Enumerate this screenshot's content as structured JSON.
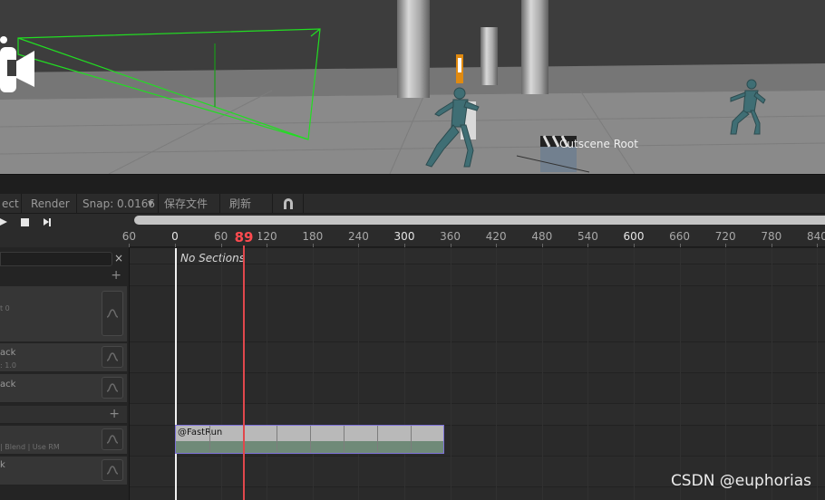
{
  "scene": {
    "object_label": "Cutscene Root",
    "warning_glyph": "!"
  },
  "toolbar": {
    "partial_label": "ect",
    "render_label": "Render",
    "snap_label": "Snap: 0.0166",
    "save_label": "保存文件",
    "refresh_label": "刷新",
    "magnet_icon": "magnet-icon"
  },
  "transport": {
    "play_icon": "play-icon",
    "stop_icon": "stop-icon",
    "step_icon": "step-forward-icon"
  },
  "ruler": {
    "ticks": [
      "60",
      "0",
      "60",
      "120",
      "180",
      "240",
      "300",
      "360",
      "420",
      "480",
      "540",
      "600",
      "660",
      "720",
      "780",
      "840"
    ],
    "major": [
      "0",
      "300",
      "600"
    ]
  },
  "playhead": {
    "frame": "89"
  },
  "left_panel": {
    "close_glyph": "×",
    "plus_glyph": "+",
    "rows": [
      {
        "title": "",
        "sub": "t 0"
      },
      {
        "title": "ack",
        "sub": ": 1.0"
      },
      {
        "title": "ack",
        "sub": ""
      },
      {
        "title": "",
        "sub": "| Blend | Use RM"
      },
      {
        "title": "k",
        "sub": ""
      }
    ]
  },
  "timeline": {
    "sections_text": "No Sections",
    "clip_label": "@FastRun"
  },
  "watermark": "CSDN @euphorias",
  "colors": {
    "playhead": "#e0474c",
    "clip_border": "#7e72d8",
    "camera_frustum": "#22dd22"
  }
}
